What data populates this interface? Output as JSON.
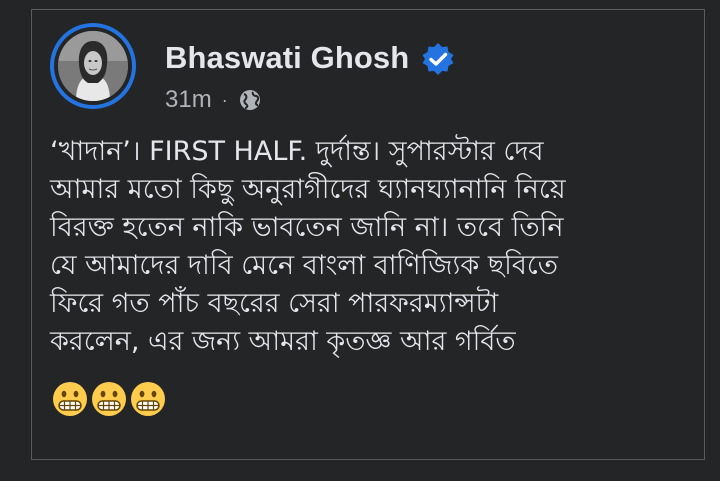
{
  "post": {
    "author_name": "Bhaswati Ghosh",
    "timestamp": "31m",
    "separator": "·",
    "privacy_icon": "globe-icon",
    "verified_icon": "verified-badge-icon",
    "lines": [
      "‘খাদান’। FIRST HALF. দুর্দান্ত। সুপারস্টার দেব",
      "আমার মতো কিছু অনুরাগীদের ঘ্যানঘ্যানানি নিয়ে",
      "বিরক্ত হতেন নাকি ভাবতেন জানি না। তবে তিনি",
      "যে আমাদের দাবি মেনে বাংলা বাণিজ্যিক ছবিতে",
      "ফিরে গত পাঁচ বছরের সেরা পারফরম্যান্সটা",
      "করলেন, এর জন্য আমরা কৃতজ্ঞ আর গর্বিত"
    ],
    "emojis": [
      "grimacing-face-emoji",
      "grimacing-face-emoji",
      "grimacing-face-emoji"
    ]
  },
  "colors": {
    "background": "#242526",
    "text_primary": "#e4e6eb",
    "text_secondary": "#b0b3b8",
    "accent_blue": "#2374e1"
  }
}
